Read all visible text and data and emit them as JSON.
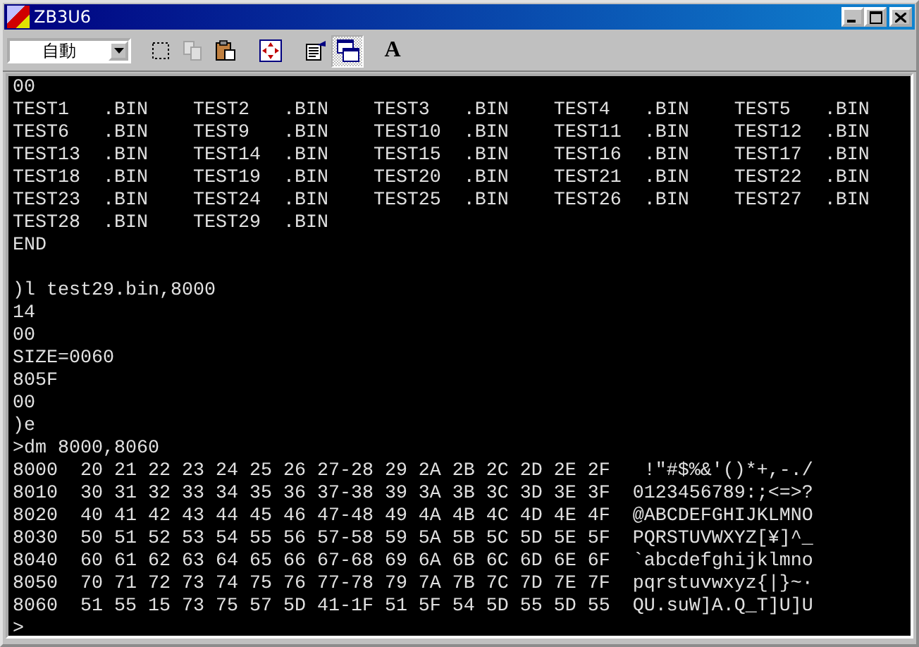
{
  "window": {
    "title": "ZB3U6"
  },
  "toolbar": {
    "font_size_dropdown": {
      "value": "自動"
    },
    "buttons": [
      {
        "kind": "mark",
        "pressed": false,
        "disabled": false
      },
      {
        "kind": "copy",
        "pressed": false,
        "disabled": true
      },
      {
        "kind": "paste",
        "pressed": false,
        "disabled": false
      },
      {
        "kind": "fullscreen",
        "pressed": false,
        "disabled": false
      },
      {
        "kind": "properties",
        "pressed": false,
        "disabled": false
      },
      {
        "kind": "background",
        "pressed": true,
        "disabled": false
      },
      {
        "kind": "font",
        "label": "A",
        "pressed": false,
        "disabled": false
      }
    ]
  },
  "console": {
    "blocks": [
      [
        "00",
        "TEST1   .BIN    TEST2   .BIN    TEST3   .BIN    TEST4   .BIN    TEST5   .BIN",
        "TEST6   .BIN    TEST9   .BIN    TEST10  .BIN    TEST11  .BIN    TEST12  .BIN",
        "TEST13  .BIN    TEST14  .BIN    TEST15  .BIN    TEST16  .BIN    TEST17  .BIN",
        "TEST18  .BIN    TEST19  .BIN    TEST20  .BIN    TEST21  .BIN    TEST22  .BIN",
        "TEST23  .BIN    TEST24  .BIN    TEST25  .BIN    TEST26  .BIN    TEST27  .BIN",
        "TEST28  .BIN    TEST29  .BIN",
        "END"
      ],
      [
        ")l test29.bin,8000",
        "14",
        "00",
        "SIZE=0060",
        "805F",
        "00",
        ")e",
        ">dm 8000,8060",
        "8000  20 21 22 23 24 25 26 27-28 29 2A 2B 2C 2D 2E 2F   !\"#$%&'()*+,-./",
        "8010  30 31 32 33 34 35 36 37-38 39 3A 3B 3C 3D 3E 3F  0123456789:;<=>?",
        "8020  40 41 42 43 44 45 46 47-48 49 4A 4B 4C 4D 4E 4F  @ABCDEFGHIJKLMNO",
        "8030  50 51 52 53 54 55 56 57-58 59 5A 5B 5C 5D 5E 5F  PQRSTUVWXYZ[¥]^_",
        "8040  60 61 62 63 64 65 66 67-68 69 6A 6B 6C 6D 6E 6F  `abcdefghijklmno",
        "8050  70 71 72 73 74 75 76 77-78 79 7A 7B 7C 7D 7E 7F  pqrstuvwxyz{|}~·",
        "8060  51 55 15 73 75 57 5D 41-1F 51 5F 54 5D 55 5D 55  QU.suW]A.Q_T]U]U",
        ">"
      ]
    ]
  }
}
